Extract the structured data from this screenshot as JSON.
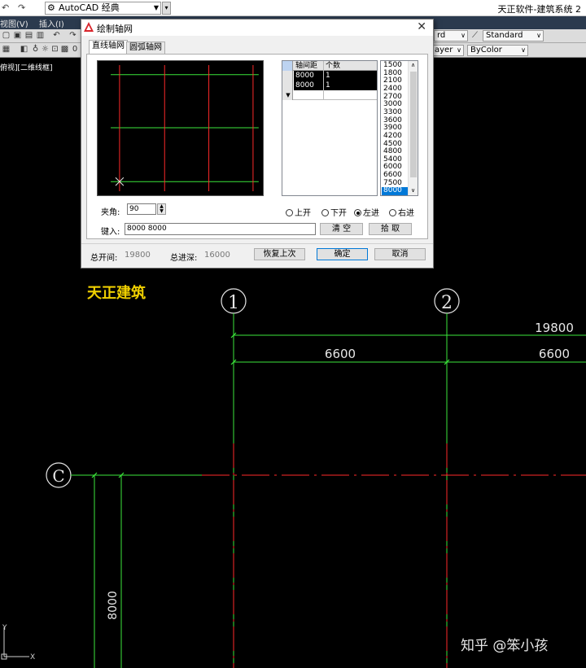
{
  "app": {
    "workspace": "AutoCAD 经典",
    "title": "天正软件-建筑系统 2"
  },
  "menu": [
    "视图(V)",
    "插入(I)"
  ],
  "toolbar": {
    "textstyle_combo": "rd",
    "dimstyle_combo": "Standard",
    "layer_combo": "ayer",
    "color_combo": "ByColor",
    "layer_num": "0"
  },
  "viewport_label": "俯视][二维线框]",
  "dialog": {
    "title": "绘制轴网",
    "tabs": [
      {
        "label": "直线轴网",
        "active": true
      },
      {
        "label": "圆弧轴网",
        "active": false
      }
    ],
    "table": {
      "headers": [
        "轴间距",
        "个数"
      ],
      "rows": [
        {
          "spacing": "8000",
          "count": "1"
        },
        {
          "spacing": "8000",
          "count": "1"
        }
      ]
    },
    "spacing_list": [
      "1500",
      "1800",
      "2100",
      "2400",
      "2700",
      "3000",
      "3300",
      "3600",
      "3900",
      "4200",
      "4500",
      "4800",
      "5400",
      "6000",
      "6600",
      "7500",
      "8000"
    ],
    "spacing_selected": "8000",
    "angle_label": "夹角:",
    "angle_value": "90",
    "radios": [
      {
        "label": "上开",
        "checked": false
      },
      {
        "label": "下开",
        "checked": false
      },
      {
        "label": "左进",
        "checked": true
      },
      {
        "label": "右进",
        "checked": false
      }
    ],
    "key_label": "键入:",
    "key_value": "8000  8000",
    "clear_button": "清  空",
    "pick_button": "拾  取",
    "total_width_label": "总开间:",
    "total_width_value": "19800",
    "total_depth_label": "总进深:",
    "total_depth_value": "16000",
    "restore_button": "恢复上次",
    "ok_button": "确定",
    "cancel_button": "取消"
  },
  "drawing": {
    "brand": "天正建筑",
    "axis_labels": [
      "1",
      "2",
      "C"
    ],
    "dims": [
      "19800",
      "6600",
      "6600",
      "8000"
    ],
    "ucs": {
      "y": "Y",
      "x": "X"
    },
    "colors": {
      "axis": "#ff2a2a",
      "dim": "#3be63b",
      "text": "#ffffff"
    }
  },
  "watermark": "知乎 @笨小孩"
}
